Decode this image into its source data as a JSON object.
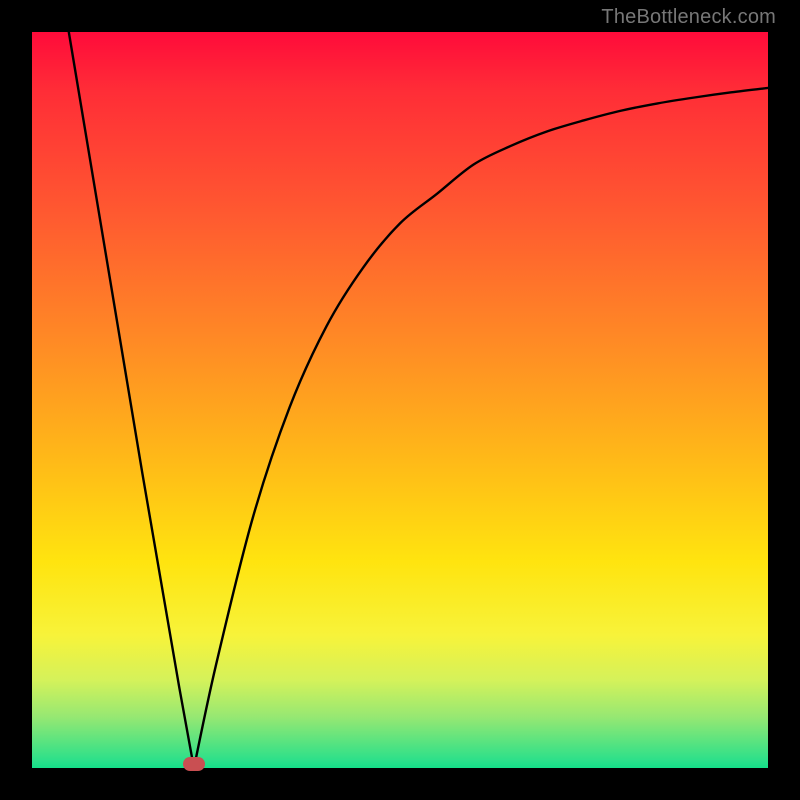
{
  "watermark": "TheBottleneck.com",
  "chart_data": {
    "type": "line",
    "title": "",
    "xlabel": "",
    "ylabel": "",
    "xlim": [
      0,
      100
    ],
    "ylim": [
      0,
      100
    ],
    "gradient_colors_top_to_bottom": [
      "#ff0b3a",
      "#ff8a25",
      "#ffe40f",
      "#14df89"
    ],
    "min_point": {
      "x": 22,
      "y": 0
    },
    "marker_color": "#c94f52",
    "x": [
      5,
      10,
      15,
      20,
      22,
      25,
      30,
      35,
      40,
      45,
      50,
      55,
      60,
      65,
      70,
      75,
      80,
      85,
      90,
      95,
      100
    ],
    "values": [
      100,
      70,
      40,
      11,
      0,
      14,
      34,
      49,
      60,
      68,
      74,
      78,
      82,
      84.5,
      86.5,
      88,
      89.3,
      90.3,
      91.1,
      91.8,
      92.4
    ]
  }
}
